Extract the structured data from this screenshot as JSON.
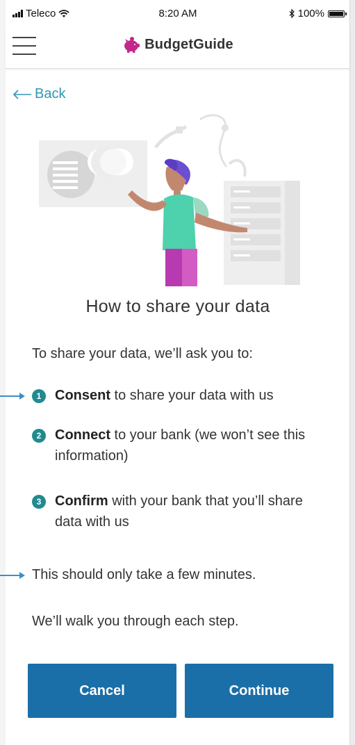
{
  "status_bar": {
    "carrier": "Teleco",
    "time": "8:20 AM",
    "battery_percent": "100%",
    "battery_level": 1.0,
    "icons": [
      "signal-icon",
      "wifi-icon",
      "bluetooth-icon",
      "battery-icon"
    ]
  },
  "header": {
    "brand_name": "BudgetGuide",
    "menu_icon": "hamburger-menu-icon",
    "logo_icon": "piggy-bank-icon",
    "brand_color": "#c2298a"
  },
  "back": {
    "label": "Back",
    "icon": "arrow-left-icon"
  },
  "main": {
    "title": "How to share your data",
    "intro": "To share your data, we’ll ask you to:",
    "steps": [
      {
        "number": "1",
        "bold": "Consent",
        "rest": " to share your data with us"
      },
      {
        "number": "2",
        "bold": "Connect",
        "rest": " to your bank (we won’t see this information)"
      },
      {
        "number": "3",
        "bold": "Confirm",
        "rest": " with your bank that you’ll share data with us"
      }
    ],
    "note_time": "This should only take a few minutes.",
    "note_walk": "We’ll walk you through each step."
  },
  "buttons": {
    "cancel": "Cancel",
    "continue": "Continue"
  },
  "colors": {
    "accent": "#2f96b4",
    "button": "#1b6fa8",
    "step_badge": "#218a8f",
    "pointer": "#3a8fc8"
  }
}
